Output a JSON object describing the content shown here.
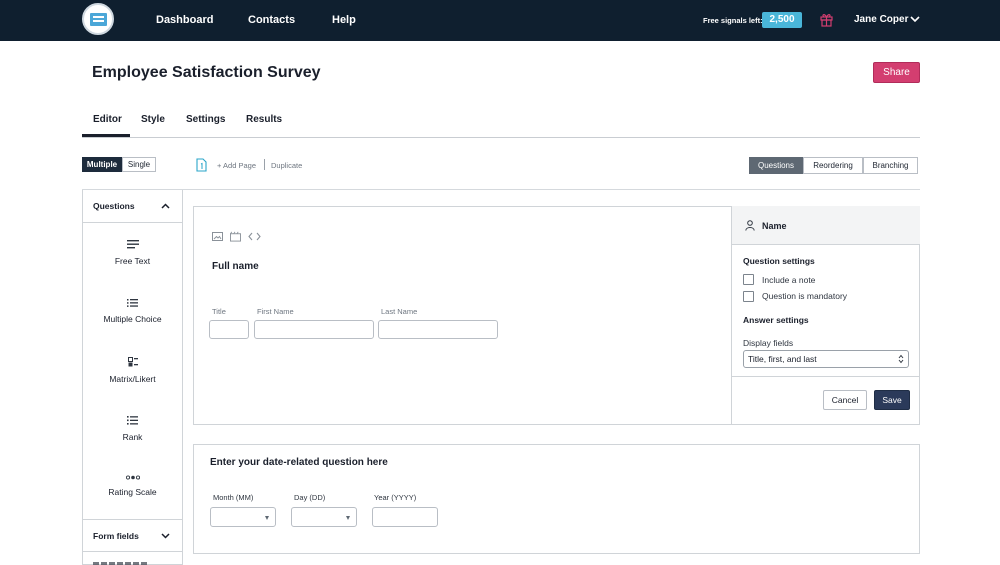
{
  "nav": {
    "links": [
      "Dashboard",
      "Contacts",
      "Help"
    ],
    "free_signals_label": "Free signals left:",
    "free_signals_count": "2,500",
    "user_name": "Jane Coper"
  },
  "header": {
    "title": "Employee Satisfaction Survey",
    "share_label": "Share"
  },
  "tabs": [
    "Editor",
    "Style",
    "Settings",
    "Results"
  ],
  "active_tab": "Editor",
  "toolbar": {
    "mode_toggle": [
      "Multiple",
      "Single"
    ],
    "active_mode": "Multiple",
    "add_page_label": "+ Add Page",
    "duplicate_label": "Duplicate",
    "view_toggle": [
      "Questions",
      "Reordering",
      "Branching"
    ],
    "active_view": "Questions"
  },
  "sidebar": {
    "questions_header": "Questions",
    "question_types": [
      {
        "label": "Free Text",
        "icon": "free-text-icon"
      },
      {
        "label": "Multiple Choice",
        "icon": "multiple-choice-icon"
      },
      {
        "label": "Matrix/Likert",
        "icon": "matrix-icon"
      },
      {
        "label": "Rank",
        "icon": "rank-icon"
      },
      {
        "label": "Rating Scale",
        "icon": "rating-scale-icon"
      }
    ],
    "form_fields_header": "Form fields"
  },
  "question1": {
    "title": "Full name",
    "fields": [
      {
        "label": "Title",
        "value": ""
      },
      {
        "label": "First Name",
        "value": ""
      },
      {
        "label": "Last Name",
        "value": ""
      }
    ]
  },
  "settings": {
    "header": "Name",
    "question_settings_heading": "Question settings",
    "options": [
      {
        "label": "Include a note",
        "checked": false
      },
      {
        "label": "Question is mandatory",
        "checked": false
      }
    ],
    "answer_settings_heading": "Answer settings",
    "display_fields_label": "Display fields",
    "display_fields_value": "Title, first, and last",
    "cancel_label": "Cancel",
    "save_label": "Save"
  },
  "question2": {
    "title": "Enter your date-related question here",
    "fields": [
      {
        "label": "Month (MM)",
        "value": ""
      },
      {
        "label": "Day (DD)",
        "value": ""
      },
      {
        "label": "Year (YYYY)",
        "value": ""
      }
    ]
  },
  "colors": {
    "topbar": "#0f1f2f",
    "share": "#d33e70",
    "badge": "#4ab6d9",
    "save": "#2b3a5a"
  }
}
